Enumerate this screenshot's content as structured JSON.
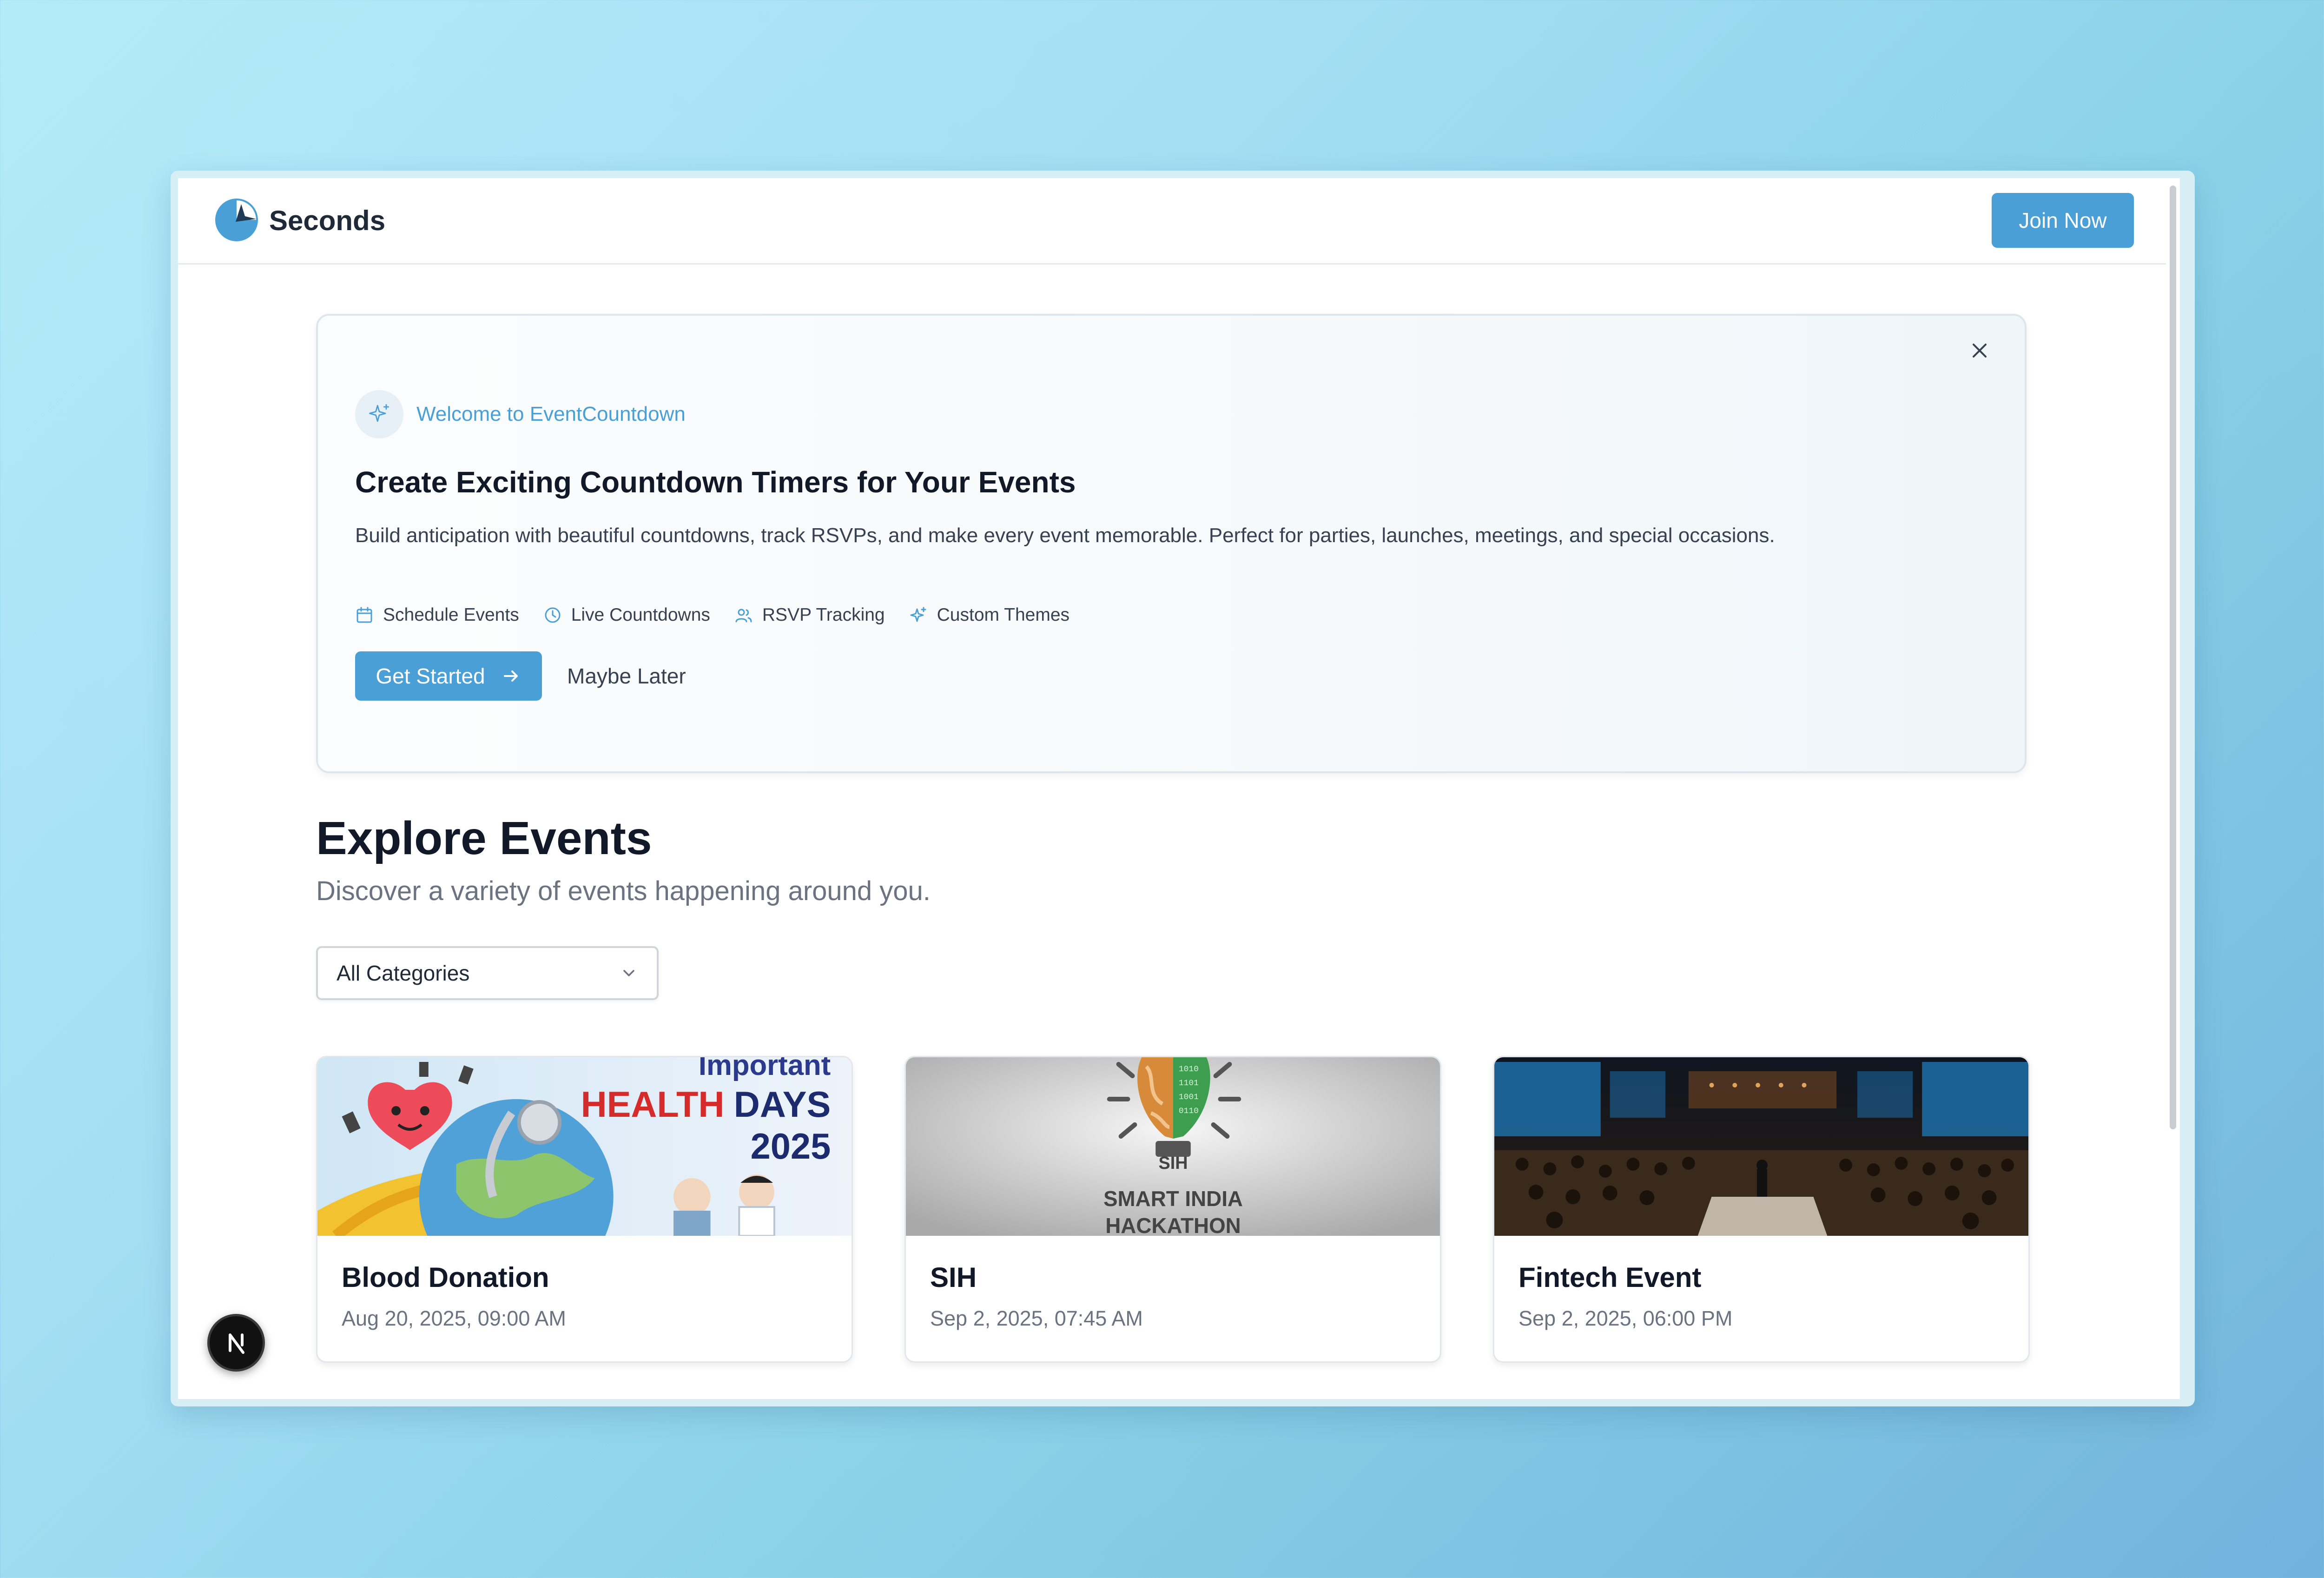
{
  "header": {
    "brand": "Seconds",
    "join_label": "Join Now"
  },
  "welcome": {
    "badge_text": "Welcome to EventCountdown",
    "title": "Create Exciting Countdown Timers for Your Events",
    "description": "Build anticipation with beautiful countdowns, track RSVPs, and make every event memorable. Perfect for parties, launches, meetings, and special occasions.",
    "features": [
      {
        "label": "Schedule Events",
        "icon": "calendar-icon"
      },
      {
        "label": "Live Countdowns",
        "icon": "clock-icon"
      },
      {
        "label": "RSVP Tracking",
        "icon": "users-icon"
      },
      {
        "label": "Custom Themes",
        "icon": "sparkle-icon"
      }
    ],
    "get_started_label": "Get Started",
    "maybe_later_label": "Maybe Later"
  },
  "explore": {
    "title": "Explore Events",
    "subtitle": "Discover a variety of events happening around you.",
    "category_selected": "All Categories"
  },
  "events": [
    {
      "title": "Blood Donation",
      "date": "Aug 20, 2025, 09:00 AM",
      "image_text": {
        "line1": "Important",
        "line2a": "HEALTH",
        "line2b": "DAYS",
        "line3": "2025"
      }
    },
    {
      "title": "SIH",
      "date": "Sep 2, 2025, 07:45 AM",
      "image_text": {
        "logo": "SIH",
        "line1": "SMART INDIA",
        "line2": "HACKATHON"
      }
    },
    {
      "title": "Fintech Event",
      "date": "Sep 2, 2025, 06:00 PM",
      "image_text": {}
    }
  ],
  "colors": {
    "accent": "#4a9fd6",
    "text_dark": "#111827",
    "text_muted": "#6b7280"
  }
}
